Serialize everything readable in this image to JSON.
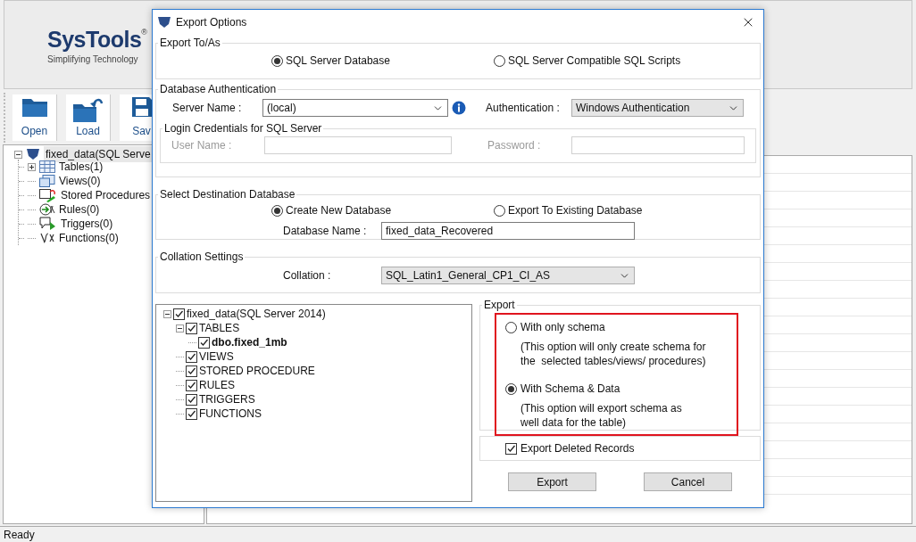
{
  "app": {
    "logo": {
      "brand": "SysTools",
      "mark": "®",
      "tagline": "Simplifying Technology"
    },
    "toolbar": [
      {
        "label": "Open",
        "kind": "open"
      },
      {
        "label": "Load",
        "kind": "load"
      },
      {
        "label": "Sav",
        "kind": "save"
      }
    ],
    "tree": {
      "label": "fixed_data(SQL Serve",
      "kind": "database",
      "expanded": true,
      "children": [
        {
          "label": "Tables(1)",
          "kind": "tables",
          "expanded": false
        },
        {
          "label": "Views(0)",
          "kind": "views"
        },
        {
          "label": "Stored Procedures",
          "kind": "procedures"
        },
        {
          "label": "Rules(0)",
          "kind": "rules"
        },
        {
          "label": "Triggers(0)",
          "kind": "triggers"
        },
        {
          "label": "Functions(0)",
          "kind": "functions"
        }
      ]
    },
    "status_bar": "Ready"
  },
  "dialog": {
    "title": "Export Options",
    "export_to": {
      "title": "Export To/As",
      "options": [
        {
          "label": "SQL Server Database",
          "selected": true
        },
        {
          "label": "SQL Server Compatible SQL Scripts",
          "selected": false
        }
      ]
    },
    "authentication": {
      "title": "Database Authentication",
      "server_label": "Server Name :",
      "server_value": "(local)",
      "auth_label": "Authentication :",
      "auth_value": "Windows Authentication",
      "login": {
        "title": "Login Credentials for SQL Server",
        "disabled": true,
        "user_label": "User Name :",
        "password_label": "Password :"
      }
    },
    "destination": {
      "title": "Select Destination Database",
      "options": [
        {
          "label": "Create New Database",
          "selected": true
        },
        {
          "label": "Export To Existing Database",
          "selected": false
        }
      ],
      "name_label": "Database Name :",
      "name_value": "fixed_data_Recovered"
    },
    "collation": {
      "title": "Collation Settings",
      "label": "Collation :",
      "value": "SQL_Latin1_General_CP1_CI_AS"
    },
    "tree": {
      "label": "fixed_data(SQL Server 2014)",
      "checked": true,
      "expanded": true,
      "children": [
        {
          "label": "TABLES",
          "checked": true,
          "expanded": true,
          "children": [
            {
              "label": "dbo.fixed_1mb",
              "checked": true,
              "kind": "table"
            }
          ]
        },
        {
          "label": "VIEWS",
          "checked": true
        },
        {
          "label": "STORED PROCEDURE",
          "checked": true
        },
        {
          "label": "RULES",
          "checked": true
        },
        {
          "label": "TRIGGERS",
          "checked": true
        },
        {
          "label": "FUNCTIONS",
          "checked": true
        }
      ]
    },
    "export": {
      "title": "Export",
      "options": [
        {
          "label": "With only schema",
          "description": "(This option will only create schema for\nthe  selected tables/views/ procedures)",
          "selected": false
        },
        {
          "label": "With Schema & Data",
          "description": "(This option will export schema as\nwell data for the table)",
          "selected": true
        }
      ]
    },
    "deleted_records": {
      "label": "Export Deleted Records",
      "checked": true
    },
    "buttons": [
      "Export",
      "Cancel"
    ]
  }
}
